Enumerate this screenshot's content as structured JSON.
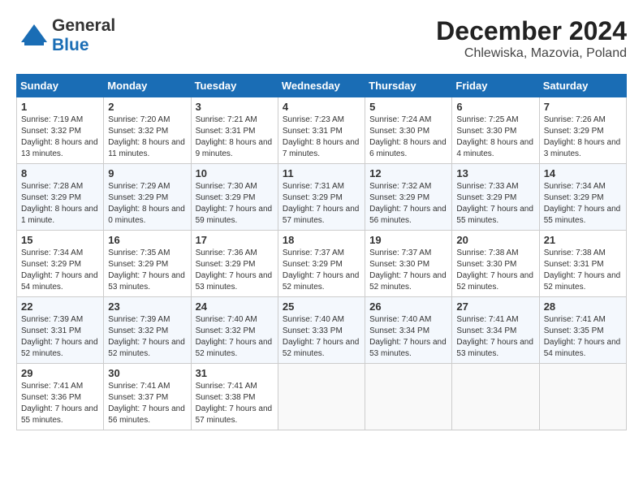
{
  "header": {
    "logo_line1": "General",
    "logo_line2": "Blue",
    "month": "December 2024",
    "location": "Chlewiska, Mazovia, Poland"
  },
  "columns": [
    "Sunday",
    "Monday",
    "Tuesday",
    "Wednesday",
    "Thursday",
    "Friday",
    "Saturday"
  ],
  "weeks": [
    [
      {
        "day": "1",
        "sunrise": "7:19 AM",
        "sunset": "3:32 PM",
        "daylight": "8 hours and 13 minutes."
      },
      {
        "day": "2",
        "sunrise": "7:20 AM",
        "sunset": "3:32 PM",
        "daylight": "8 hours and 11 minutes."
      },
      {
        "day": "3",
        "sunrise": "7:21 AM",
        "sunset": "3:31 PM",
        "daylight": "8 hours and 9 minutes."
      },
      {
        "day": "4",
        "sunrise": "7:23 AM",
        "sunset": "3:31 PM",
        "daylight": "8 hours and 7 minutes."
      },
      {
        "day": "5",
        "sunrise": "7:24 AM",
        "sunset": "3:30 PM",
        "daylight": "8 hours and 6 minutes."
      },
      {
        "day": "6",
        "sunrise": "7:25 AM",
        "sunset": "3:30 PM",
        "daylight": "8 hours and 4 minutes."
      },
      {
        "day": "7",
        "sunrise": "7:26 AM",
        "sunset": "3:29 PM",
        "daylight": "8 hours and 3 minutes."
      }
    ],
    [
      {
        "day": "8",
        "sunrise": "7:28 AM",
        "sunset": "3:29 PM",
        "daylight": "8 hours and 1 minute."
      },
      {
        "day": "9",
        "sunrise": "7:29 AM",
        "sunset": "3:29 PM",
        "daylight": "8 hours and 0 minutes."
      },
      {
        "day": "10",
        "sunrise": "7:30 AM",
        "sunset": "3:29 PM",
        "daylight": "7 hours and 59 minutes."
      },
      {
        "day": "11",
        "sunrise": "7:31 AM",
        "sunset": "3:29 PM",
        "daylight": "7 hours and 57 minutes."
      },
      {
        "day": "12",
        "sunrise": "7:32 AM",
        "sunset": "3:29 PM",
        "daylight": "7 hours and 56 minutes."
      },
      {
        "day": "13",
        "sunrise": "7:33 AM",
        "sunset": "3:29 PM",
        "daylight": "7 hours and 55 minutes."
      },
      {
        "day": "14",
        "sunrise": "7:34 AM",
        "sunset": "3:29 PM",
        "daylight": "7 hours and 55 minutes."
      }
    ],
    [
      {
        "day": "15",
        "sunrise": "7:34 AM",
        "sunset": "3:29 PM",
        "daylight": "7 hours and 54 minutes."
      },
      {
        "day": "16",
        "sunrise": "7:35 AM",
        "sunset": "3:29 PM",
        "daylight": "7 hours and 53 minutes."
      },
      {
        "day": "17",
        "sunrise": "7:36 AM",
        "sunset": "3:29 PM",
        "daylight": "7 hours and 53 minutes."
      },
      {
        "day": "18",
        "sunrise": "7:37 AM",
        "sunset": "3:29 PM",
        "daylight": "7 hours and 52 minutes."
      },
      {
        "day": "19",
        "sunrise": "7:37 AM",
        "sunset": "3:30 PM",
        "daylight": "7 hours and 52 minutes."
      },
      {
        "day": "20",
        "sunrise": "7:38 AM",
        "sunset": "3:30 PM",
        "daylight": "7 hours and 52 minutes."
      },
      {
        "day": "21",
        "sunrise": "7:38 AM",
        "sunset": "3:31 PM",
        "daylight": "7 hours and 52 minutes."
      }
    ],
    [
      {
        "day": "22",
        "sunrise": "7:39 AM",
        "sunset": "3:31 PM",
        "daylight": "7 hours and 52 minutes."
      },
      {
        "day": "23",
        "sunrise": "7:39 AM",
        "sunset": "3:32 PM",
        "daylight": "7 hours and 52 minutes."
      },
      {
        "day": "24",
        "sunrise": "7:40 AM",
        "sunset": "3:32 PM",
        "daylight": "7 hours and 52 minutes."
      },
      {
        "day": "25",
        "sunrise": "7:40 AM",
        "sunset": "3:33 PM",
        "daylight": "7 hours and 52 minutes."
      },
      {
        "day": "26",
        "sunrise": "7:40 AM",
        "sunset": "3:34 PM",
        "daylight": "7 hours and 53 minutes."
      },
      {
        "day": "27",
        "sunrise": "7:41 AM",
        "sunset": "3:34 PM",
        "daylight": "7 hours and 53 minutes."
      },
      {
        "day": "28",
        "sunrise": "7:41 AM",
        "sunset": "3:35 PM",
        "daylight": "7 hours and 54 minutes."
      }
    ],
    [
      {
        "day": "29",
        "sunrise": "7:41 AM",
        "sunset": "3:36 PM",
        "daylight": "7 hours and 55 minutes."
      },
      {
        "day": "30",
        "sunrise": "7:41 AM",
        "sunset": "3:37 PM",
        "daylight": "7 hours and 56 minutes."
      },
      {
        "day": "31",
        "sunrise": "7:41 AM",
        "sunset": "3:38 PM",
        "daylight": "7 hours and 57 minutes."
      },
      null,
      null,
      null,
      null
    ]
  ]
}
